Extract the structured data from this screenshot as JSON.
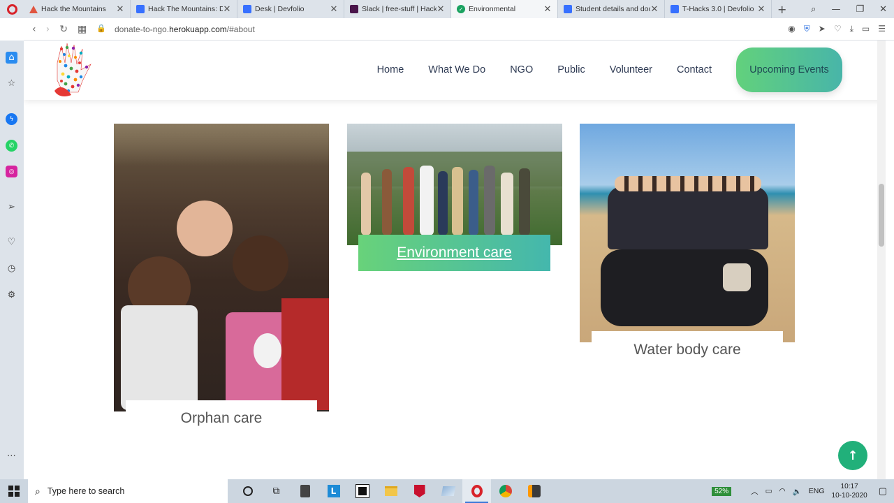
{
  "browser": {
    "tabs": [
      {
        "title": "Hack the Mountains",
        "color": "#e0553f",
        "active": false
      },
      {
        "title": "Hack The Mountains: Da",
        "color": "#3770ff",
        "active": false
      },
      {
        "title": "Desk | Devfolio",
        "color": "#3770ff",
        "active": false
      },
      {
        "title": "Slack | free-stuff | Hack",
        "color": "#4a154b",
        "active": false
      },
      {
        "title": "Environmental",
        "color": "#1aa260",
        "active": true
      },
      {
        "title": "Student details and doc",
        "color": "#3770ff",
        "active": false
      },
      {
        "title": "T-Hacks 3.0 | Devfolio",
        "color": "#3770ff",
        "active": false
      }
    ],
    "url_domain_prefix": "donate-to-ngo.",
    "url_domain_main": "herokuapp.com",
    "url_path": "/#about"
  },
  "site": {
    "nav": [
      "Home",
      "What We Do",
      "NGO",
      "Public",
      "Volunteer",
      "Contact"
    ],
    "cta": "Upcoming Events",
    "cards": [
      {
        "caption": "Orphan care"
      },
      {
        "caption": "Environment care"
      },
      {
        "caption": "Water body care"
      }
    ],
    "accent": "#21b07a"
  },
  "taskbar": {
    "search_placeholder": "Type here to search",
    "battery": "52%",
    "language": "ENG",
    "time": "10:17",
    "date": "10-10-2020"
  }
}
